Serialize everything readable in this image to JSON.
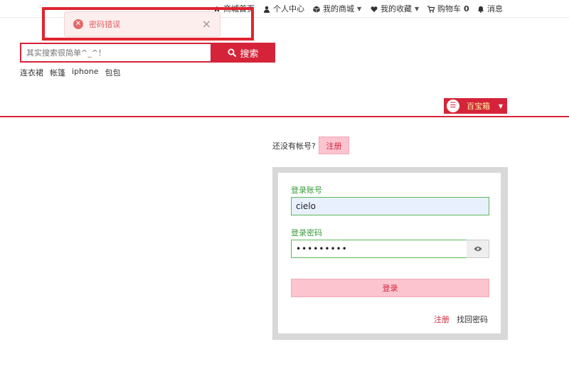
{
  "topnav": {
    "items": [
      {
        "label": "商城首页",
        "icon": "home-icon"
      },
      {
        "label": "个人中心",
        "icon": "user-icon"
      },
      {
        "label": "我的商城",
        "icon": "cube-icon",
        "caret": true
      },
      {
        "label": "我的收藏",
        "icon": "heart-icon",
        "caret": true
      },
      {
        "label": "购物车",
        "icon": "cart-icon",
        "count": "0"
      },
      {
        "label": "消息",
        "icon": "bell-icon"
      }
    ]
  },
  "toast": {
    "message": "密码错误",
    "close": "×",
    "error_icon": "✕"
  },
  "search": {
    "placeholder": "其实搜索很简单^_^！",
    "button_label": "搜索"
  },
  "hot_words": [
    "连衣裙",
    "帐篷",
    "iphone",
    "包包"
  ],
  "treasure": {
    "label": "百宝箱",
    "icon_text": "☰"
  },
  "register_prompt": {
    "text": "还没有帐号?",
    "button_label": "注册"
  },
  "login": {
    "account_label": "登录账号",
    "account_value": "cielo",
    "password_label": "登录密码",
    "password_value": "•••••••••",
    "submit_label": "登录",
    "register_link": "注册",
    "forgot_link": "找回密码"
  },
  "colors": {
    "accent": "#d5243a",
    "label_green": "#3a9a3a",
    "toast_bg": "#fdeeee",
    "highlight": "#e0242f"
  }
}
